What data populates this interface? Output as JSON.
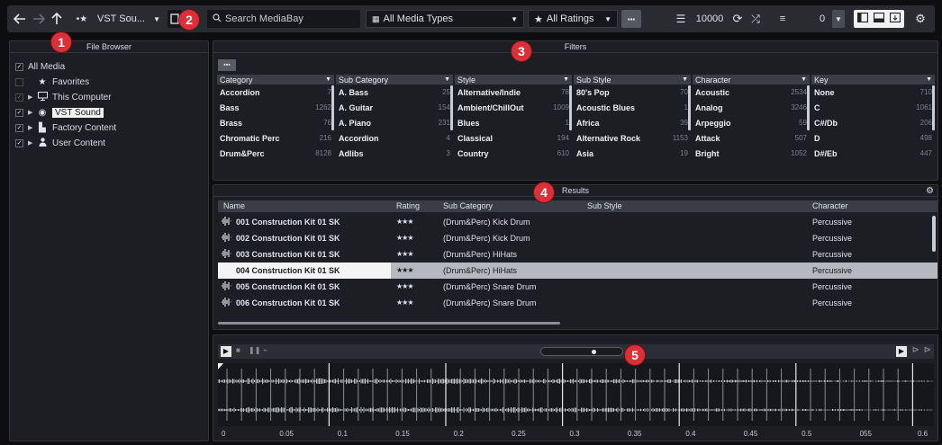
{
  "toolbar": {
    "vst_source": "VST Sou...",
    "search_placeholder": "Search MediaBay",
    "media_types": "All Media Types",
    "ratings": "All Ratings",
    "result_count": "10000",
    "zero_value": "0"
  },
  "callouts": [
    "1",
    "2",
    "3",
    "4",
    "5"
  ],
  "file_browser": {
    "title": "File Browser",
    "items": [
      {
        "label": "All Media"
      },
      {
        "label": "Favorites"
      },
      {
        "label": "This Computer"
      },
      {
        "label": "VST Sound"
      },
      {
        "label": "Factory Content"
      },
      {
        "label": "User Content"
      }
    ]
  },
  "filters": {
    "title": "Filters",
    "columns": [
      {
        "header": "Category",
        "rows": [
          [
            "Accordion",
            "7"
          ],
          [
            "Bass",
            "1262"
          ],
          [
            "Brass",
            "76"
          ],
          [
            "Chromatic Perc",
            "216"
          ],
          [
            "Drum&Perc",
            "8128"
          ]
        ]
      },
      {
        "header": "Sub Category",
        "rows": [
          [
            "A. Bass",
            "25"
          ],
          [
            "A. Guitar",
            "154"
          ],
          [
            "A. Piano",
            "231"
          ],
          [
            "Accordion",
            "4"
          ],
          [
            "Adlibs",
            "3"
          ]
        ]
      },
      {
        "header": "Style",
        "rows": [
          [
            "Alternative/Indie",
            "78"
          ],
          [
            "Ambient/ChillOut",
            "1009"
          ],
          [
            "Blues",
            "1"
          ],
          [
            "Classical",
            "194"
          ],
          [
            "Country",
            "610"
          ]
        ]
      },
      {
        "header": "Sub Style",
        "rows": [
          [
            "80's Pop",
            "70"
          ],
          [
            "Acoustic Blues",
            "1"
          ],
          [
            "Africa",
            "39"
          ],
          [
            "Alternative Rock",
            "1153"
          ],
          [
            "Asia",
            "19"
          ]
        ]
      },
      {
        "header": "Character",
        "rows": [
          [
            "Acoustic",
            "2534"
          ],
          [
            "Analog",
            "3246"
          ],
          [
            "Arpeggio",
            "59"
          ],
          [
            "Attack",
            "507"
          ],
          [
            "Bright",
            "1052"
          ]
        ]
      },
      {
        "header": "Key",
        "rows": [
          [
            "None",
            "710"
          ],
          [
            "C",
            "1061"
          ],
          [
            "C#/Db",
            "206"
          ],
          [
            "D",
            "498"
          ],
          [
            "D#/Eb",
            "447"
          ]
        ]
      }
    ]
  },
  "results": {
    "title": "Results",
    "headers": {
      "name": "Name",
      "rating": "Rating",
      "sub_category": "Sub Category",
      "sub_style": "Sub Style",
      "character": "Character"
    },
    "rows": [
      {
        "name": "001 Construction Kit 01 SK",
        "rating": "★★★",
        "sub_category": "(Drum&Perc) Kick Drum",
        "character": "Percussive"
      },
      {
        "name": "002 Construction Kit 01 SK",
        "rating": "★★★",
        "sub_category": "(Drum&Perc) Kick Drum",
        "character": "Percussive"
      },
      {
        "name": "003 Construction Kit 01 SK",
        "rating": "★★★",
        "sub_category": "(Drum&Perc) HiHats",
        "character": "Percussive"
      },
      {
        "name": "004 Construction Kit 01 SK",
        "rating": "★★★",
        "sub_category": "(Drum&Perc) HiHats",
        "character": "Percussive"
      },
      {
        "name": "005 Construction Kit 01 SK",
        "rating": "★★★",
        "sub_category": "(Drum&Perc) Snare Drum",
        "character": "Percussive"
      },
      {
        "name": "006 Construction Kit 01 SK",
        "rating": "★★★",
        "sub_category": "(Drum&Perc) Snare Drum",
        "character": "Percussive"
      }
    ],
    "selected_index": 3
  },
  "previewer": {
    "ruler": [
      "0",
      "0.05",
      "0.1",
      "0.15",
      "0.2",
      "0.25",
      "0.3",
      "0.35",
      "0.4",
      "0.45",
      "0.5",
      "055",
      "0.6"
    ]
  }
}
